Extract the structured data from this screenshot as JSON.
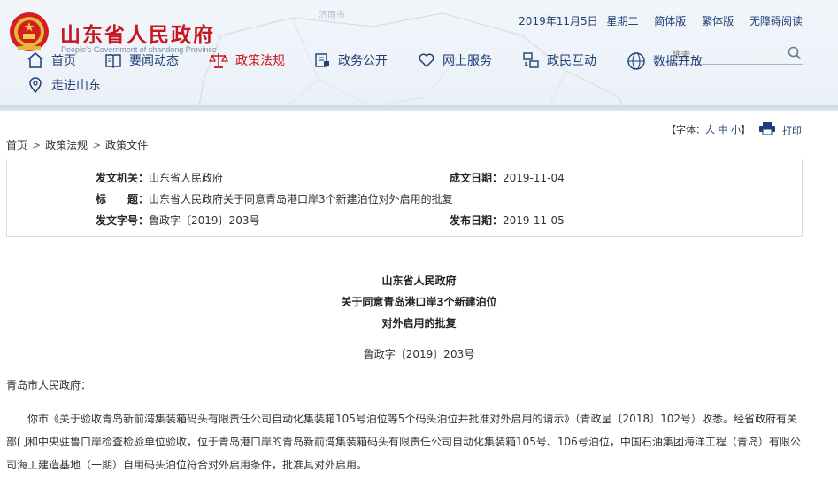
{
  "header": {
    "title": "山东省人民政府",
    "subtitle": "People's Government of shandong Province",
    "map_label": "济南市"
  },
  "topbar": {
    "date": "2019年11月5日",
    "weekday": "星期二",
    "simplified": "简体版",
    "traditional": "繁体版",
    "accessible": "无障碍阅读"
  },
  "search": {
    "placeholder": "搜索"
  },
  "nav": [
    {
      "label": "首页",
      "icon": "home-icon"
    },
    {
      "label": "要闻动态",
      "icon": "news-icon"
    },
    {
      "label": "政策法规",
      "icon": "scales-icon",
      "active": true
    },
    {
      "label": "政务公开",
      "icon": "government-icon"
    },
    {
      "label": "网上服务",
      "icon": "heart-icon"
    },
    {
      "label": "政民互动",
      "icon": "interaction-icon"
    },
    {
      "label": "数据开放",
      "icon": "data-globe-icon"
    },
    {
      "label": "走进山东",
      "icon": "location-pin-icon"
    }
  ],
  "font_control": {
    "open": "【字体：",
    "large": "大",
    "medium": "中",
    "small": "小",
    "close": "】"
  },
  "print": {
    "label": "打印"
  },
  "breadcrumb": {
    "home": "首页",
    "sep": ">",
    "policy": "政策法规",
    "docs": "政策文件"
  },
  "meta": {
    "issuer_label": "发文机关：",
    "issuer": "山东省人民政府",
    "date_label": "成文日期：",
    "date": "2019-11-04",
    "title_label": "标　　题：",
    "title": "山东省人民政府关于同意青岛港口岸3个新建泊位对外启用的批复",
    "number_label": "发文字号：",
    "number": "鲁政字〔2019〕203号",
    "publish_label": "发布日期：",
    "publish": "2019-11-05"
  },
  "document": {
    "head1": "山东省人民政府",
    "head2": "关于同意青岛港口岸3个新建泊位",
    "head3": "对外启用的批复",
    "number": "鲁政字〔2019〕203号",
    "salutation": "青岛市人民政府：",
    "body": "你市《关于验收青岛新前湾集装箱码头有限责任公司自动化集装箱105号泊位等5个码头泊位并批准对外启用的请示》（青政呈〔2018〕102号）收悉。经省政府有关部门和中央驻鲁口岸检查检验单位验收，位于青岛港口岸的青岛新前湾集装箱码头有限责任公司自动化集装箱105号、106号泊位，中国石油集团海洋工程（青岛）有限公司海工建造基地（一期）自用码头泊位符合对外启用条件，批准其对外启用。"
  },
  "colors": {
    "brand_red": "#c7161d",
    "nav_blue": "#1f3f77",
    "header_bg": "#eef3f9"
  }
}
